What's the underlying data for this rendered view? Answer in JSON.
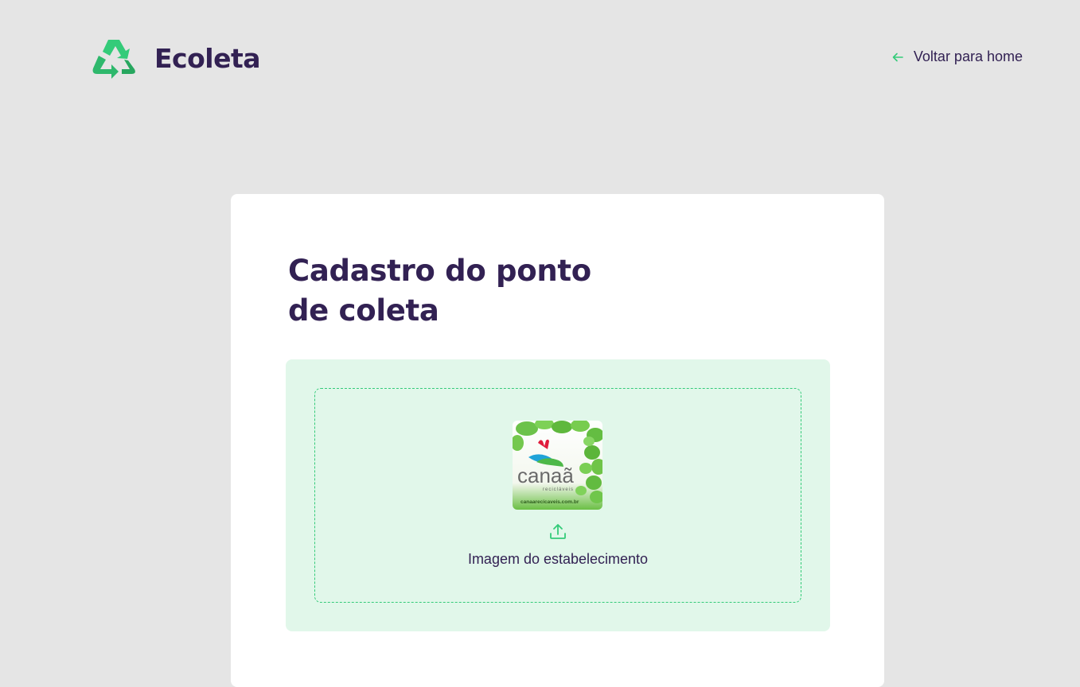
{
  "header": {
    "logo_text": "Ecoleta",
    "back_link": "Voltar para home"
  },
  "form": {
    "title": "Cadastro do ponto de coleta",
    "title_line1": "Cadastro do ponto",
    "title_line2": "de coleta",
    "dropzone_label": "Imagem do estabelecimento",
    "preview_image": {
      "brand": "canaã",
      "subtitle": "recicláveis",
      "url_text": "canaarecicaveis.com.br"
    }
  },
  "colors": {
    "background": "#e5e5e5",
    "brand_dark": "#322153",
    "accent_green": "#34cb79",
    "dropzone_bg": "#e1f7ea",
    "card_bg": "#ffffff"
  },
  "icons": {
    "logo": "recycle-icon",
    "back": "arrow-left-icon",
    "upload": "upload-icon"
  }
}
